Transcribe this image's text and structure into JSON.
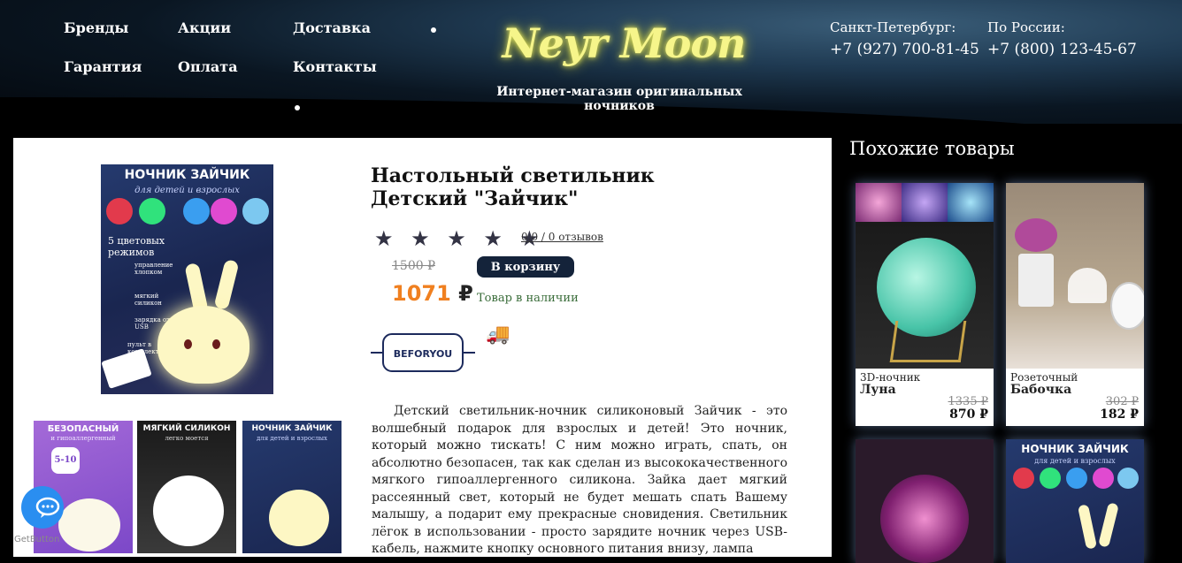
{
  "nav": {
    "brands": "Бренды",
    "promos": "Акции",
    "delivery": "Доставка",
    "warranty": "Гарантия",
    "payment": "Оплата",
    "contacts": "Контакты"
  },
  "logo": {
    "text": "Neyr Moon",
    "tagline": "Интернет-магазин оригинальных ночников"
  },
  "phones": {
    "spb_label": "Санкт-Петербург:",
    "spb_number": "+7 (927) 700-81-45",
    "russia_label": "По России:",
    "russia_number": "+7 (800) 123-45-67"
  },
  "product": {
    "title_line1": "Настольный светильник",
    "title_line2": "Детский \"Зайчик\"",
    "stars": "★ ★ ★ ★ ★",
    "rating": 0,
    "reviews": "0.0 / 0 отзывов",
    "old_price": "1500 ₽",
    "new_price": "1071",
    "currency": "₽",
    "cart_button": "В корзину",
    "stock": "Товар в наличии",
    "brand_name": "BEFORYOU",
    "truck_icon": "delivery-truck-icon",
    "description": "Детский светильник-ночник силиконовый Зайчик - это волшебный подарок для взрослых и детей! Это ночник, который можно тискать! С ним можно играть, спать, он абсолютно безопасен, так как сделан из высококачественного мягкого гипоаллергенного силикона. Зайка дает мягкий рассеянный свет, который не будет мешать спать Вашему малышу, а подарит ему прекрасные сновидения. Светильник лёгок в использовании - просто зарядите ночник через USB-кабель, нажмите кнопку основного питания внизу, лампа",
    "image": {
      "title": "НОЧНИК ЗАЙЧИК",
      "subtitle": "для детей и взрослых",
      "modes": "5 цветовых режимов",
      "feature1": "управление хлопком",
      "feature2": "мягкий силикон",
      "feature3": "зарядка от USB",
      "feature4": "пульт в комплекте"
    },
    "thumbs": [
      {
        "title": "БЕЗОПАСНЫЙ",
        "subtitle": "и гипоаллергенный",
        "badge": "5-10"
      },
      {
        "title": "МЯГКИЙ СИЛИКОН",
        "subtitle": "легко моется"
      },
      {
        "title": "НОЧНИК ЗАЙЧИК",
        "subtitle": "для детей и взрослых"
      }
    ]
  },
  "similar": {
    "title": "Похожие товары",
    "items": [
      {
        "category": "3D-ночник",
        "name": "Луна",
        "old_price": "1335 ₽",
        "new_price": "870 ₽"
      },
      {
        "category": "Розеточный",
        "name": "Бабочка",
        "old_price": "302 ₽",
        "new_price": "182 ₽"
      },
      {
        "name": "",
        "category": ""
      },
      {
        "title": "НОЧНИК ЗАЙЧИК",
        "subtitle": "для детей и взрослых"
      }
    ]
  },
  "widget": {
    "label": "GetButton"
  },
  "colors": {
    "accent_price": "#f08020",
    "button": "#14233a",
    "logo": "#f6f58a"
  }
}
